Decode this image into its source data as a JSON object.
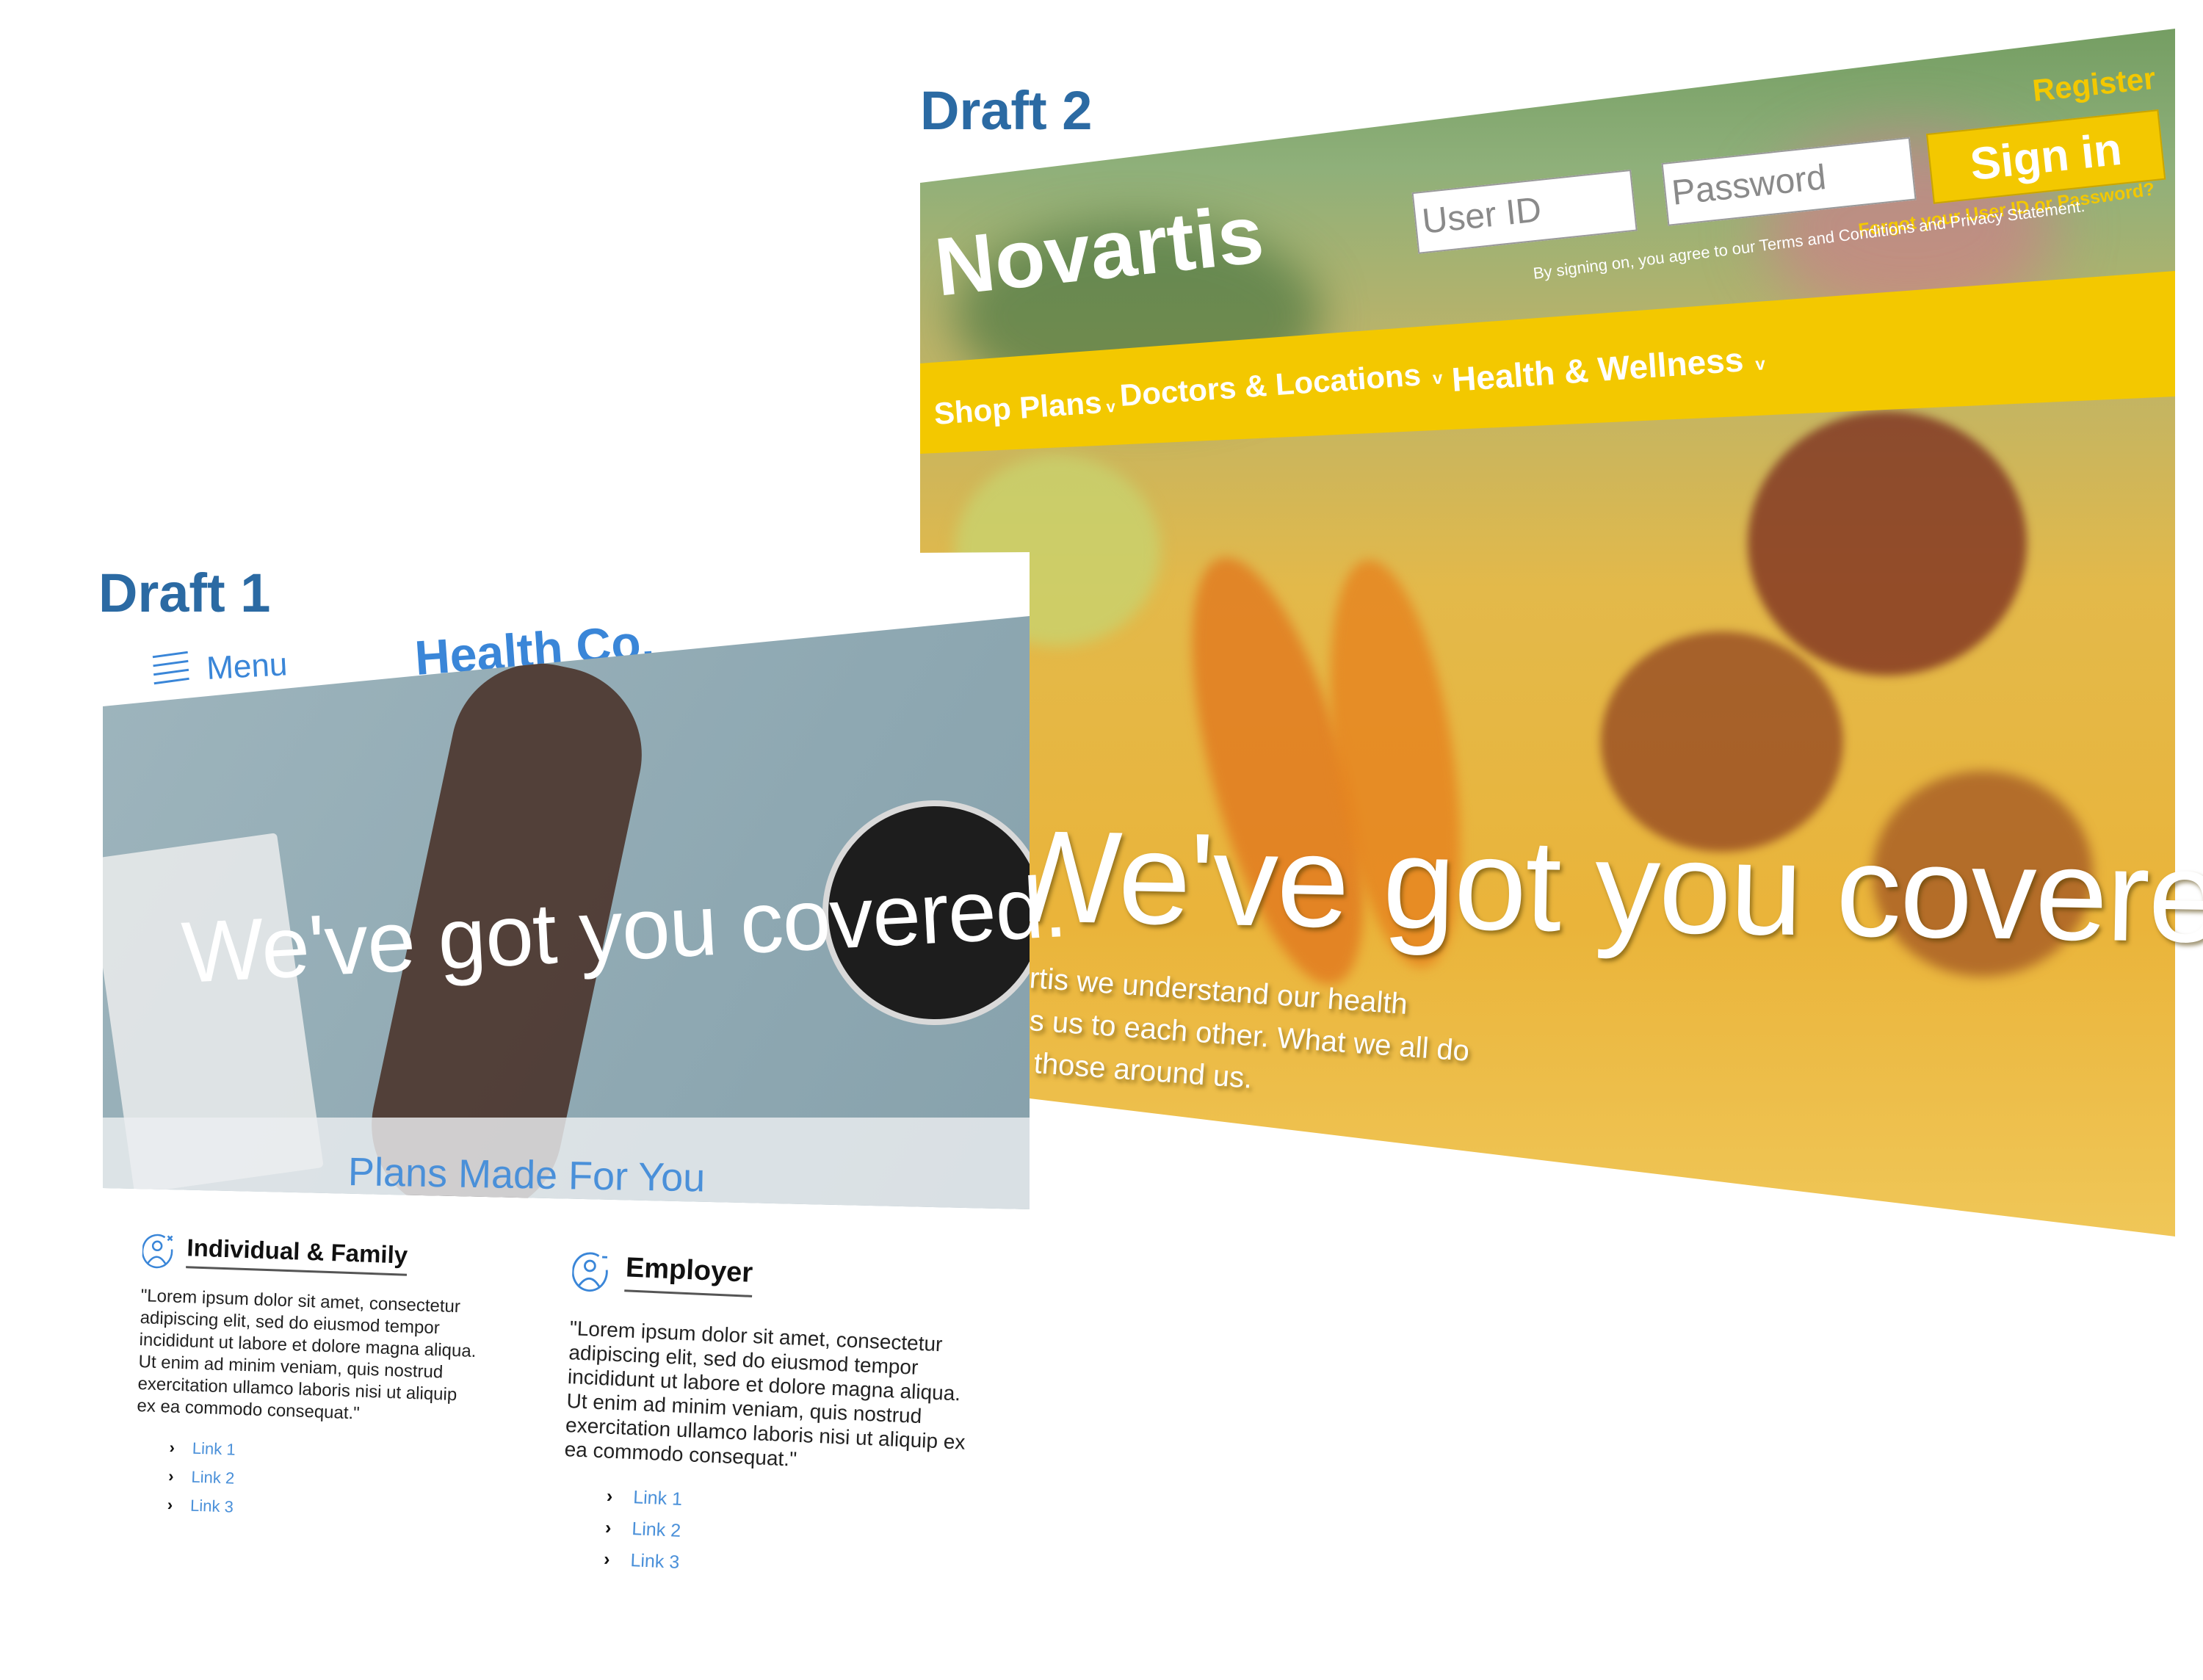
{
  "draft2": {
    "label": "Draft 2",
    "brand": "Novartis",
    "register_label": "Register",
    "user_id_placeholder": "User ID",
    "password_placeholder": "Password",
    "signin_label": "Sign in",
    "forgot_label": "Forgot your User ID or Password?",
    "terms_text": "By signing on, you agree to our Terms and Conditions and Privacy Statement.",
    "nav": [
      {
        "label": "Shop Plans",
        "chevron": "v"
      },
      {
        "label": "Doctors & Locations",
        "chevron": "v"
      },
      {
        "label": "Health & Wellness",
        "chevron": "v"
      }
    ],
    "headline": "We've got you covered.",
    "body_lines": [
      "rtis we understand our health",
      "s us to each other. What we all do",
      "those around us."
    ],
    "colors": {
      "accent": "#f3c800",
      "label": "#2b6aa3"
    }
  },
  "draft1": {
    "label": "Draft 1",
    "menu_label": "Menu",
    "brand": "Health Co.",
    "headline": "We've got you covered.",
    "plans_label": "Plans Made For You",
    "sections": [
      {
        "title": "Individual & Family",
        "icon": "person-circle-icon",
        "text": "\"Lorem ipsum dolor sit amet, consectetur adipiscing elit, sed do eiusmod tempor incididunt ut labore et dolore magna aliqua. Ut enim ad minim veniam, quis nostrud exercitation ullamco laboris nisi ut aliquip ex ea commodo consequat.\"",
        "links": [
          "Link 1",
          "Link 2",
          "Link 3"
        ]
      },
      {
        "title": "Employer",
        "icon": "person-circle-icon",
        "text": "\"Lorem ipsum dolor sit amet, consectetur adipiscing elit, sed do eiusmod tempor incididunt ut labore et dolore magna aliqua. Ut enim ad minim veniam, quis nostrud exercitation ullamco laboris nisi ut aliquip ex ea commodo consequat.\"",
        "links": [
          "Link 1",
          "Link 2",
          "Link 3"
        ]
      }
    ],
    "chevron": "›",
    "colors": {
      "accent": "#3a86d8",
      "label": "#2b6aa3"
    }
  }
}
